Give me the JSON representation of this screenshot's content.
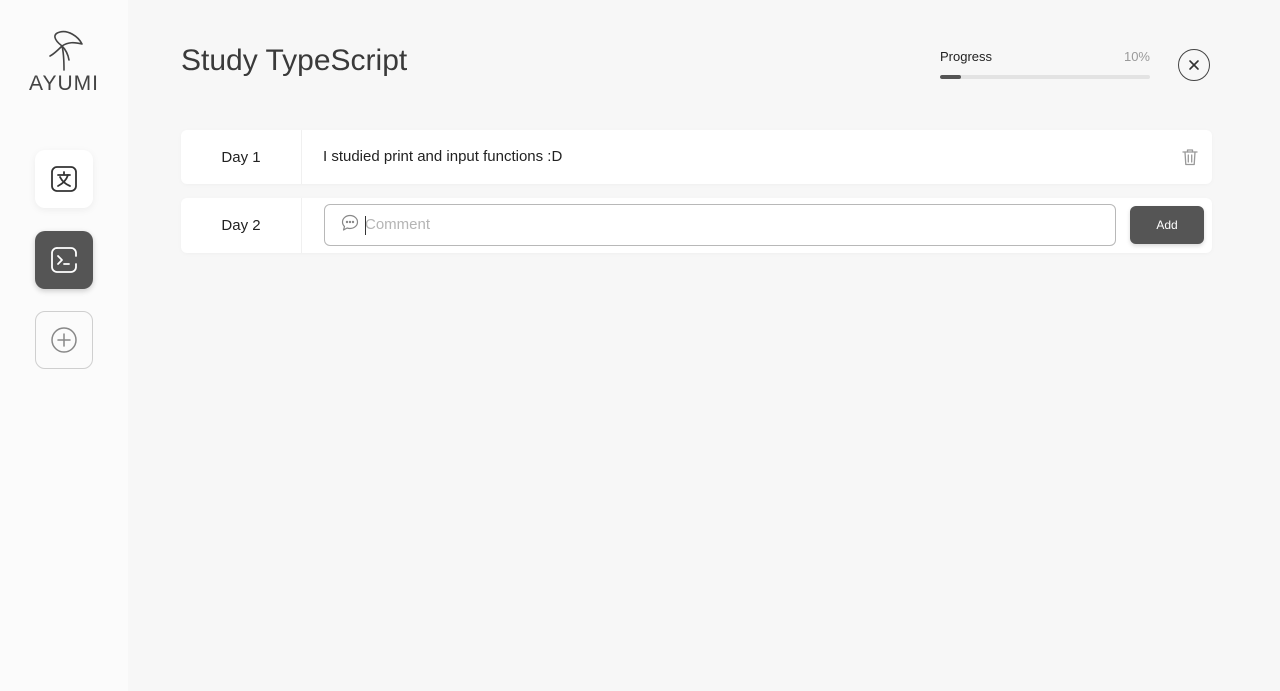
{
  "sidebar": {
    "logo_text": "AYUMI",
    "items": [
      {
        "name": "translate",
        "icon": "translate-icon",
        "active": false
      },
      {
        "name": "terminal",
        "icon": "terminal-icon",
        "active": true
      },
      {
        "name": "add",
        "icon": "plus-circle-icon",
        "active": false
      }
    ]
  },
  "header": {
    "title": "Study TypeScript",
    "progress_label": "Progress",
    "progress_value_text": "10%",
    "progress_fraction": 0.1,
    "close_icon": "close-icon"
  },
  "entries": [
    {
      "day": "Day 1",
      "text": "I studied print and input functions :D",
      "action_icon": "trash-icon"
    }
  ],
  "new_entry": {
    "day": "Day 2",
    "placeholder": "Comment",
    "value": "",
    "comment_icon": "comment-icon",
    "add_label": "Add"
  },
  "colors": {
    "accent": "#555555",
    "background": "#f7f7f7",
    "sidebar": "#fbfbfb"
  }
}
